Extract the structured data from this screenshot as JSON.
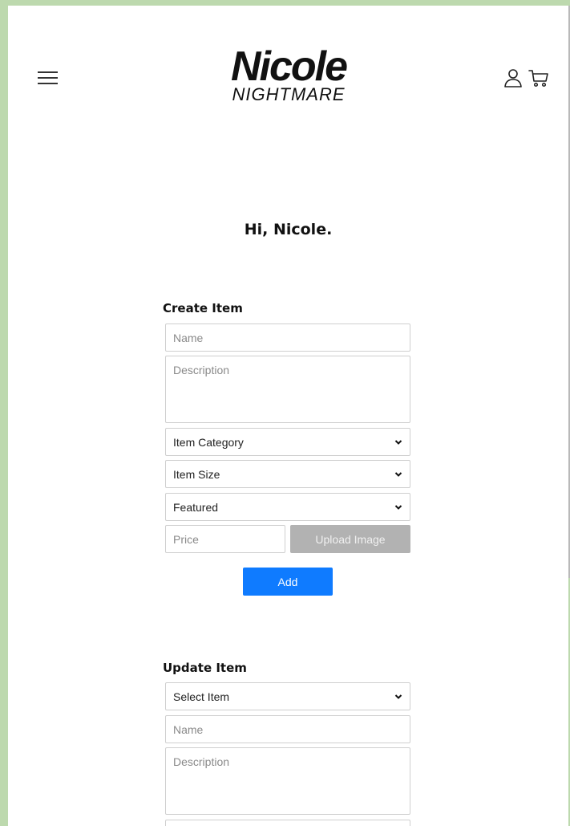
{
  "brand": {
    "name": "Nicole",
    "tagline": "NIGHTMARE"
  },
  "header": {
    "menu_icon": "hamburger-icon",
    "account_icon": "user-icon",
    "cart_icon": "cart-icon"
  },
  "greeting": "Hi, Nicole.",
  "create_item": {
    "title": "Create Item",
    "name_placeholder": "Name",
    "description_placeholder": "Description",
    "category_value": "Item Category",
    "size_value": "Item Size",
    "featured_value": "Featured",
    "price_placeholder": "Price",
    "upload_label": "Upload Image",
    "add_label": "Add"
  },
  "update_item": {
    "title": "Update Item",
    "select_value": "Select Item",
    "name_placeholder": "Name",
    "description_placeholder": "Description"
  },
  "colors": {
    "background": "#bdd9ae",
    "primary_button": "#0f7bff",
    "disabled_button": "#b2b2b2"
  }
}
